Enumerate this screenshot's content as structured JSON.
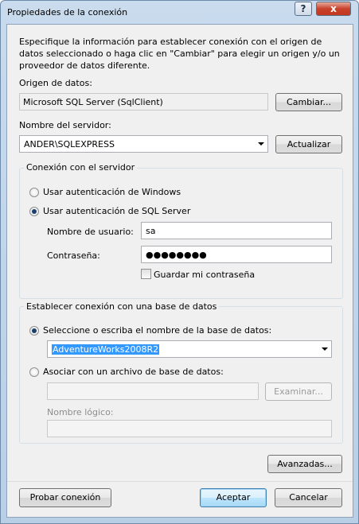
{
  "window": {
    "title": "Propiedades de la conexión",
    "help_button": "?",
    "close_button": "x"
  },
  "description": "Especifique la información para establecer conexión con el origen de datos seleccionado o haga clic en \"Cambiar\" para elegir un origen y/o un proveedor de datos diferente.",
  "datasource": {
    "label": "Origen de datos:",
    "value": "Microsoft SQL Server (SqlClient)",
    "change_button": "Cambiar..."
  },
  "server": {
    "label": "Nombre del servidor:",
    "value": "ANDER\\SQLEXPRESS",
    "refresh_button": "Actualizar"
  },
  "server_connection": {
    "group_title": "Conexión con el servidor",
    "windows_auth_label": "Usar autenticación de Windows",
    "sql_auth_label": "Usar autenticación de SQL Server",
    "selected": "sql",
    "username_label": "Nombre de usuario:",
    "username_value": "sa",
    "password_label": "Contraseña:",
    "password_value": "●●●●●●●●",
    "save_password_label": "Guardar mi contraseña",
    "save_password_checked": false
  },
  "database_connection": {
    "group_title": "Establecer conexión con una base de datos",
    "select_db_label": "Seleccione o escriba el nombre de la base de datos:",
    "db_value": "AdventureWorks2008R2",
    "attach_label": "Asociar con un archivo de base de datos:",
    "attach_value": "",
    "browse_button": "Examinar...",
    "logical_name_label": "Nombre lógico:",
    "logical_name_value": "",
    "selected": "select"
  },
  "buttons": {
    "advanced": "Avanzadas...",
    "test": "Probar conexión",
    "accept": "Aceptar",
    "cancel": "Cancelar"
  }
}
